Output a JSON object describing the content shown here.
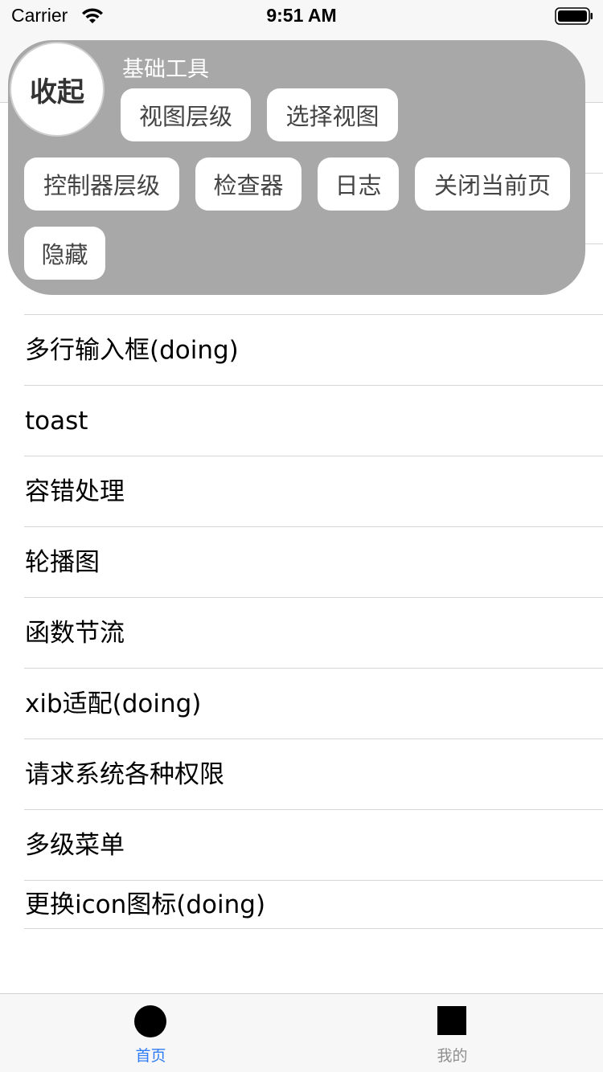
{
  "status_bar": {
    "carrier": "Carrier",
    "time": "9:51 AM"
  },
  "list": {
    "items": [
      "",
      "",
      "",
      "多行输入框(doing)",
      "toast",
      "容错处理",
      "轮播图",
      "函数节流",
      "xib适配(doing)",
      "请求系统各种权限",
      "多级菜单",
      "更换icon图标(doing)"
    ]
  },
  "tool_panel": {
    "collapse_label": "收起",
    "section_title": "基础工具",
    "buttons": {
      "view_hierarchy": "视图层级",
      "select_view": "选择视图",
      "controller_hierarchy": "控制器层级",
      "inspector": "检查器",
      "log": "日志",
      "close_page": "关闭当前页",
      "hide": "隐藏"
    },
    "colors": {
      "panel_bg": "#a8a8a8",
      "button_bg": "#ffffff"
    }
  },
  "tab_bar": {
    "home_label": "首页",
    "mine_label": "我的",
    "active_color": "#2f7cf6",
    "inactive_color": "#8e8e8e"
  }
}
